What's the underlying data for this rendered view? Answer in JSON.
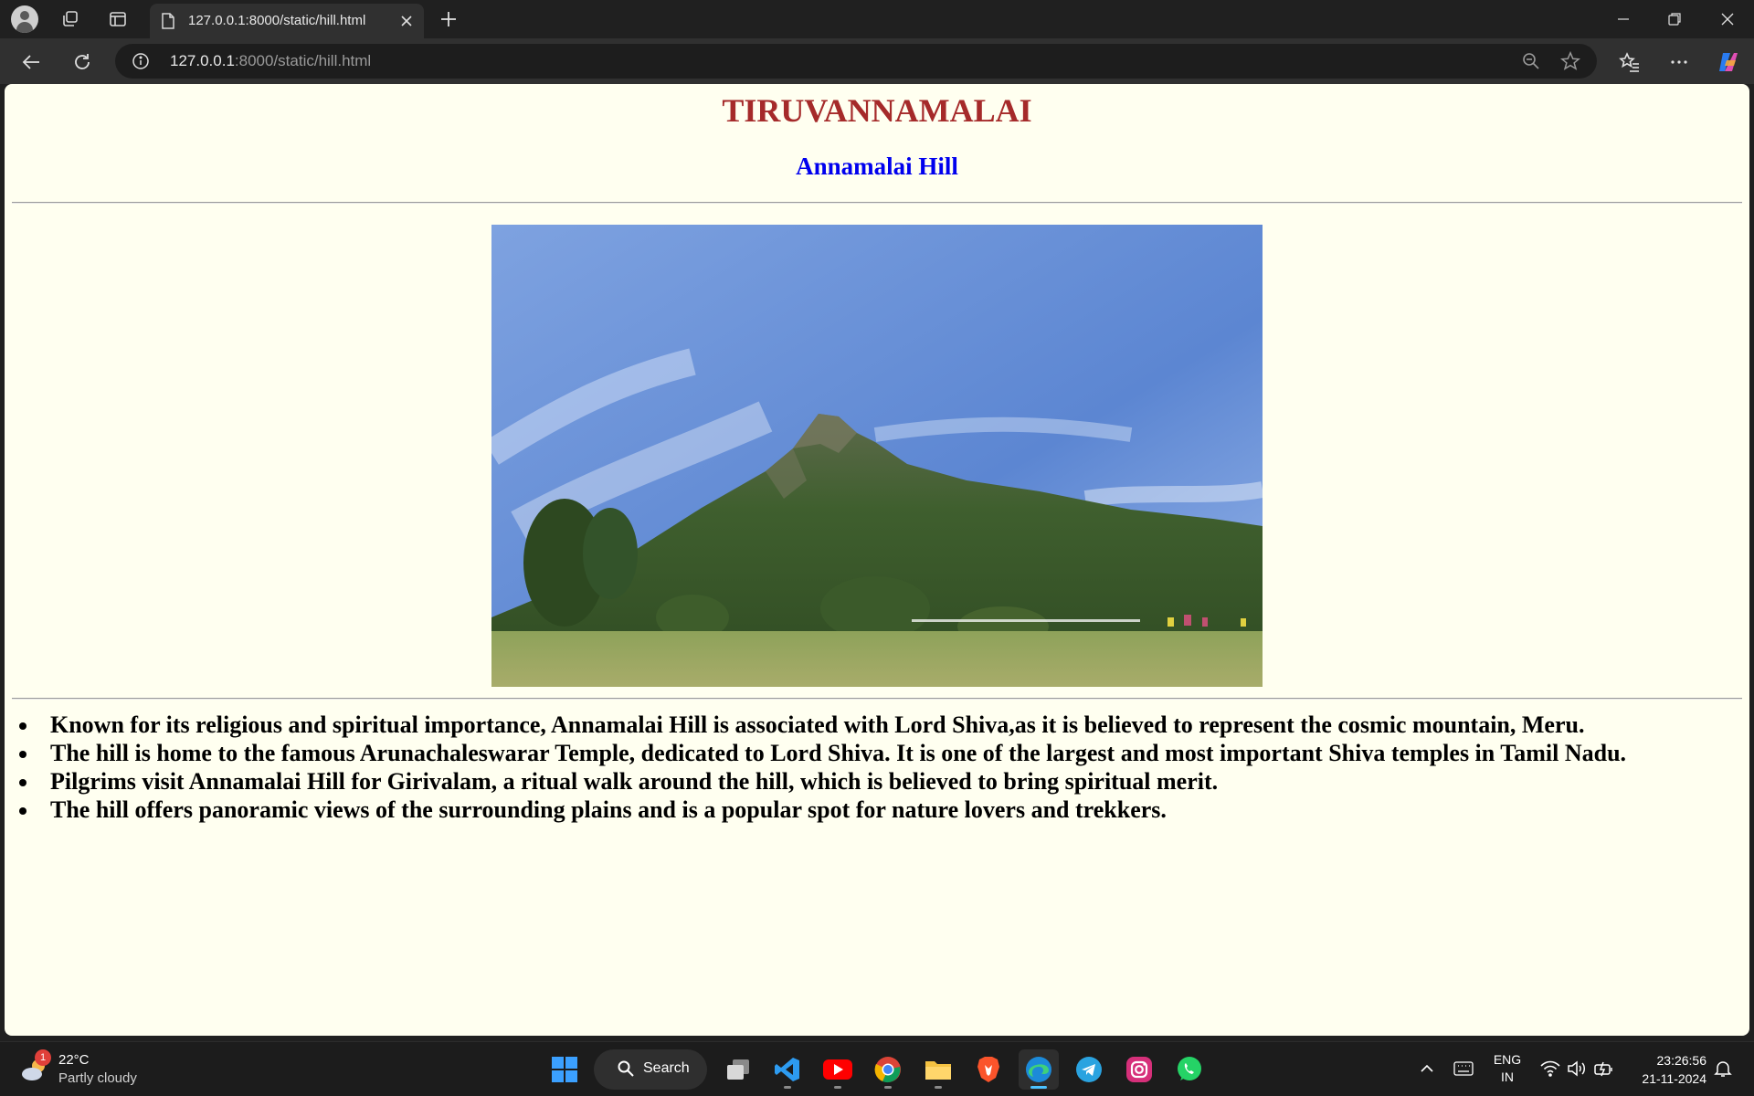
{
  "browser": {
    "tab_title": "127.0.0.1:8000/static/hill.html",
    "url_host": "127.0.0.1",
    "url_rest": ":8000/static/hill.html"
  },
  "page": {
    "title": "TIRUVANNAMALAI",
    "subtitle": "Annamalai Hill",
    "photo_subject": "Annamalai Hill landscape photo",
    "facts": [
      "Known for its religious and spiritual importance, Annamalai Hill is associated with Lord Shiva,as it is believed to represent the cosmic mountain, Meru.",
      "The hill is home to the famous Arunachaleswarar Temple, dedicated to Lord Shiva. It is one of the largest and most important Shiva temples in Tamil Nadu.",
      "Pilgrims visit Annamalai Hill for Girivalam, a ritual walk around the hill, which is believed to bring spiritual merit.",
      "The hill offers panoramic views of the surrounding plains and is a popular spot for nature lovers and trekkers."
    ],
    "colors": {
      "title": "#a52a2a",
      "subtitle": "#0000ee",
      "background": "#fffff0"
    }
  },
  "taskbar": {
    "weather_temp": "22°C",
    "weather_condition": "Partly cloudy",
    "weather_badge": "1",
    "search_label": "Search",
    "lang_line1": "ENG",
    "lang_line2": "IN",
    "time": "23:26:56",
    "date": "21-11-2024",
    "pinned_apps": [
      "task-view",
      "vscode",
      "youtube",
      "chrome",
      "file-explorer",
      "brave",
      "edge",
      "telegram",
      "instagram",
      "whatsapp"
    ]
  }
}
